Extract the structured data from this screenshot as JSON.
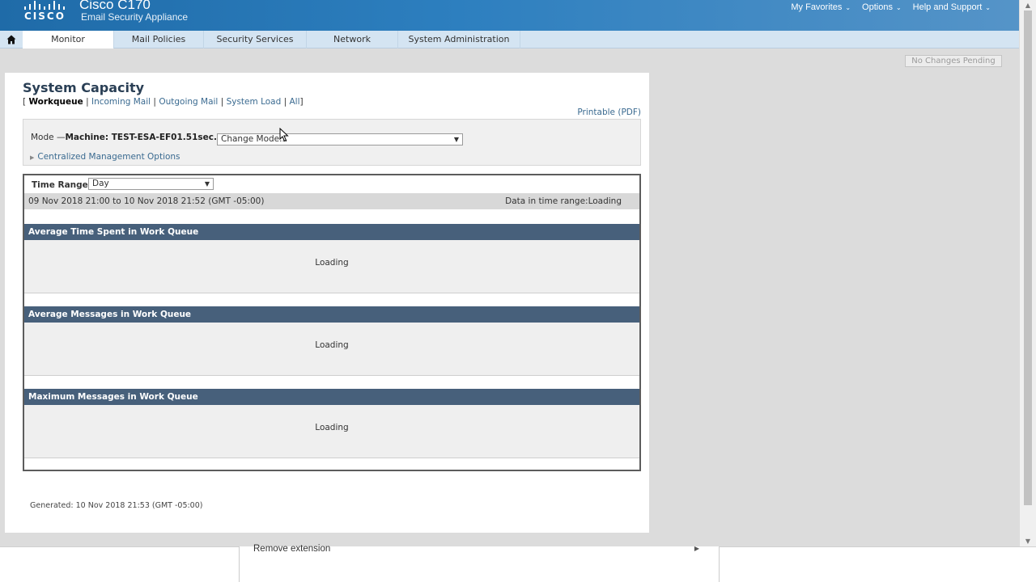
{
  "header": {
    "brand": "CISCO",
    "product": "Cisco C170",
    "subtitle": "Email Security Appliance",
    "topnav": [
      {
        "label": "My Favorites"
      },
      {
        "label": "Options"
      },
      {
        "label": "Help and Support"
      }
    ]
  },
  "tabs": [
    "Monitor",
    "Mail Policies",
    "Security Services",
    "Network",
    "System Administration"
  ],
  "active_tab": "Monitor",
  "pending_button": "No Changes Pending",
  "page": {
    "title": "System Capacity",
    "subnav": {
      "open_bracket": "[",
      "current": "Workqueue",
      "sep": "|",
      "links": [
        "Incoming Mail",
        "Outgoing Mail",
        "System Load",
        "All"
      ],
      "close_bracket": "]"
    },
    "printable": "Printable (PDF)",
    "mode": {
      "label": "Mode —",
      "machine": "Machine: TEST-ESA-EF01.51sec.ca",
      "select_value": "Change Mode...",
      "centralized": "Centralized Management Options"
    },
    "time_range": {
      "label": "Time Range:",
      "value": "Day"
    },
    "date_range": "09 Nov 2018 21:00 to 10 Nov 2018 21:52 (GMT -05:00)",
    "data_status": "Data in time range:Loading",
    "sections": [
      {
        "title": "Average Time Spent in Work Queue",
        "status": "Loading"
      },
      {
        "title": "Average Messages in Work Queue",
        "status": "Loading"
      },
      {
        "title": "Maximum Messages in Work Queue",
        "status": "Loading"
      }
    ],
    "generated": "Generated: 10 Nov 2018 21:53 (GMT -05:00)"
  },
  "context_menu": {
    "item": "Remove extension"
  },
  "icons": {
    "home": "home-icon",
    "caret": "chevron-down-icon",
    "expand": "triangle-right-icon"
  },
  "colors": {
    "header": "#2d7fbf",
    "section_header": "#47607b",
    "link": "#3a6a90"
  }
}
